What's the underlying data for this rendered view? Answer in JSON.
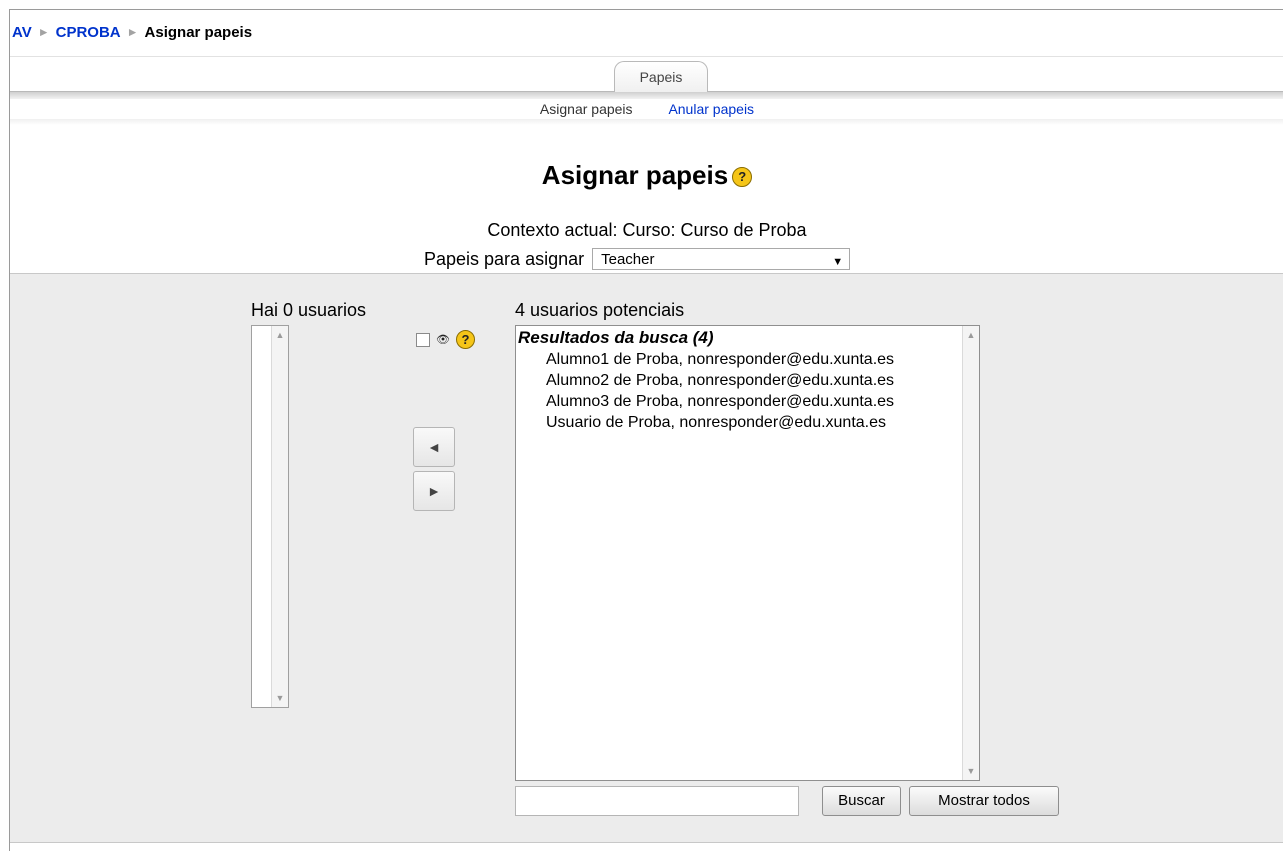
{
  "breadcrumb": {
    "items": [
      "AV",
      "CPROBA"
    ],
    "current": "Asignar papeis",
    "separator": "►"
  },
  "tabs": {
    "main": "Papeis",
    "sub": {
      "assign": "Asignar papeis",
      "override": "Anular papeis"
    }
  },
  "page": {
    "title": "Asignar papeis",
    "help_glyph": "?",
    "context": "Contexto actual: Curso: Curso de Proba",
    "role_label": "Papeis para asignar",
    "role_selected": "Teacher"
  },
  "existing": {
    "header": "Hai 0 usuarios"
  },
  "potential": {
    "header": "4 usuarios potenciais",
    "group": "Resultados da busca (4)",
    "users": [
      "Alumno1 de Proba, nonresponder@edu.xunta.es",
      "Alumno2 de Proba, nonresponder@edu.xunta.es",
      "Alumno3 de Proba, nonresponder@edu.xunta.es",
      "Usuario de Proba, nonresponder@edu.xunta.es"
    ]
  },
  "controls": {
    "add_glyph": "◄",
    "remove_glyph": "►",
    "eye_glyph": "👁"
  },
  "search": {
    "value": "",
    "search_label": "Buscar",
    "show_all_label": "Mostrar todos"
  },
  "colors": {
    "link": "#0033cc",
    "panel_bg": "#ececec",
    "help_icon": "#f5c518"
  }
}
